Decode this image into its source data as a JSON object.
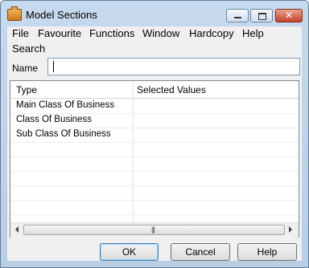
{
  "window": {
    "title": "Model Sections"
  },
  "titlebar": {
    "close_glyph": "✕"
  },
  "menu": {
    "items": [
      "File",
      "Favourite",
      "Functions",
      "Window",
      "Hardcopy",
      "Help",
      "Search"
    ]
  },
  "name_field": {
    "label": "Name",
    "value": ""
  },
  "list": {
    "columns": [
      "Type",
      "Selected Values"
    ],
    "rows": [
      {
        "type": "Main Class Of Business",
        "selected": ""
      },
      {
        "type": "Class Of Business",
        "selected": ""
      },
      {
        "type": "Sub Class Of Business",
        "selected": ""
      }
    ],
    "scroll_grip": "|||"
  },
  "buttons": {
    "ok": "OK",
    "cancel": "Cancel",
    "help": "Help"
  },
  "icons": {
    "app": "briefcase-icon",
    "minimize": "minimize-icon",
    "maximize": "maximize-icon",
    "close": "close-icon",
    "scroll_left": "arrow-left-icon",
    "scroll_right": "arrow-right-icon"
  }
}
